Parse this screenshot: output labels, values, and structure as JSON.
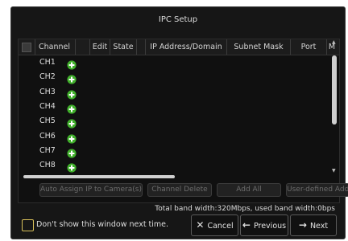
{
  "dialog": {
    "title": "IPC Setup"
  },
  "table": {
    "columns": [
      "Channel",
      "Edit",
      "State",
      "IP Address/Domain",
      "Subnet Mask",
      "Port",
      "M"
    ],
    "rows": [
      {
        "channel": "CH1"
      },
      {
        "channel": "CH2"
      },
      {
        "channel": "CH3"
      },
      {
        "channel": "CH4"
      },
      {
        "channel": "CH5"
      },
      {
        "channel": "CH6"
      },
      {
        "channel": "CH7"
      },
      {
        "channel": "CH8"
      }
    ],
    "icons": {
      "add_row": "plus-circle-icon"
    },
    "colors": {
      "add_icon": "#3fae2a"
    }
  },
  "actions": {
    "auto_assign": "Auto Assign IP to Camera(s)",
    "channel_delete": "Channel Delete",
    "add_all": "Add All",
    "user_defined_add": "User-defined Add"
  },
  "bandwidth": "Total band width:320Mbps, used band width:0bps",
  "footer": {
    "dont_show": "Don't show this window next time.",
    "cancel": "Cancel",
    "previous": "Previous",
    "next": "Next"
  }
}
